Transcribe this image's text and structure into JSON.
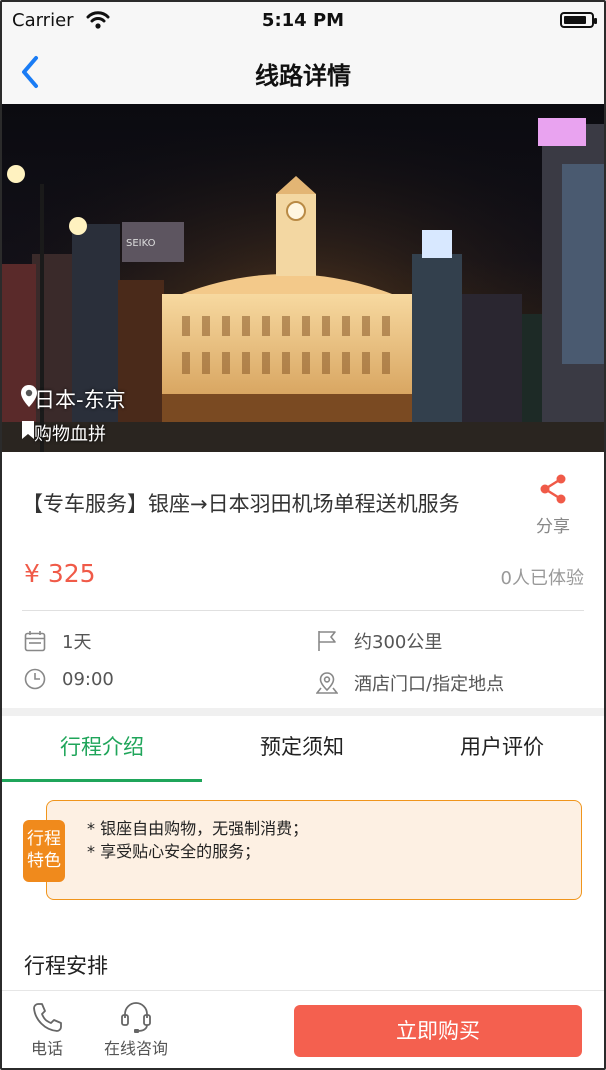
{
  "status_bar": {
    "carrier": "Carrier",
    "time": "5:14 PM"
  },
  "nav": {
    "title": "线路详情",
    "back_icon": "chevron-left-icon"
  },
  "hero": {
    "location": "日本-东京",
    "tag": "购物血拼"
  },
  "product": {
    "title": "【专车服务】银座→日本羽田机场单程送机服务",
    "share_label": "分享",
    "price": "¥ 325",
    "experienced": "0人已体验"
  },
  "info": {
    "duration": "1天",
    "distance": "约300公里",
    "time": "09:00",
    "pickup": "酒店门口/指定地点"
  },
  "tabs": [
    {
      "label": "行程介绍"
    },
    {
      "label": "预定须知"
    },
    {
      "label": "用户评价"
    }
  ],
  "feature": {
    "badge_line1": "行程",
    "badge_line2": "特色",
    "lines": [
      "* 银座自由购物，无强制消费；",
      "* 享受贴心安全的服务；"
    ]
  },
  "section": {
    "schedule_title": "行程安排"
  },
  "bottom_bar": {
    "phone_label": "电话",
    "consult_label": "在线咨询",
    "buy_label": "立即购买"
  },
  "colors": {
    "accent_green": "#1fa55a",
    "price_red": "#f05a48",
    "buy_button": "#f4604f",
    "feature_orange": "#f08a1c",
    "nav_blue": "#1a7cf5"
  }
}
